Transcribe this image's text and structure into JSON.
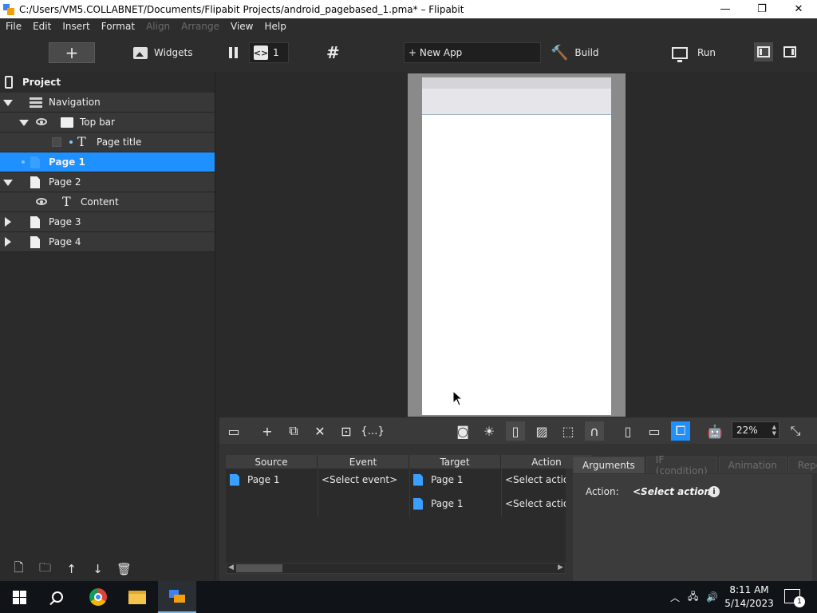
{
  "window": {
    "title": "C:/Users/VM5.COLLABNET/Documents/Flipabit Projects/android_pagebased_1.pma* – Flipabit",
    "minimize": "—",
    "maximize": "❐",
    "close": "✕"
  },
  "menu": [
    "File",
    "Edit",
    "Insert",
    "Format",
    "Align",
    "Arrange",
    "View",
    "Help"
  ],
  "toolbar": {
    "add": "+",
    "widgets": "Widgets",
    "page_number": "1",
    "code_glyph": "<>",
    "grid_glyph": "#",
    "new_app": "+ New App",
    "build": "Build",
    "run": "Run"
  },
  "project": {
    "title": "Project",
    "tree": [
      {
        "label": "Navigation"
      },
      {
        "label": "Top bar"
      },
      {
        "label": "Page title"
      },
      {
        "label": "Page 1"
      },
      {
        "label": "Page 2"
      },
      {
        "label": "Content"
      },
      {
        "label": "Page 3"
      },
      {
        "label": "Page 4"
      }
    ]
  },
  "canvas_toolbar": {
    "zoom": "22%"
  },
  "events": {
    "columns": [
      "Source",
      "Event",
      "Target",
      "Action"
    ],
    "rows": [
      {
        "source": "Page 1",
        "event": "<Select event>",
        "target": "Page 1",
        "action": "<Select action>"
      },
      {
        "source": "",
        "event": "",
        "target": "Page 1",
        "action": "<Select action>"
      }
    ]
  },
  "arguments": {
    "tabs": [
      "Arguments",
      "IF (condition)",
      "Animation",
      "Repeats"
    ],
    "action_label": "Action:",
    "action_value": "<Select action>",
    "info": "i"
  },
  "taskbar": {
    "time": "8:11 AM",
    "date": "5/14/2023",
    "notifications": "1"
  },
  "colors": {
    "accent": "#1e90ff",
    "page_icon_blue": "#3aa0ff",
    "panel_dark": "#2b2b2b"
  }
}
